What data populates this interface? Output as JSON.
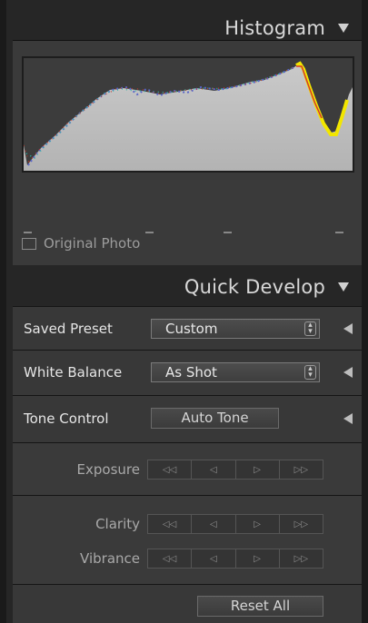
{
  "histogram": {
    "title": "Histogram",
    "original_photo_label": "Original Photo",
    "original_photo_checked": false
  },
  "quick_develop": {
    "title": "Quick Develop",
    "saved_preset": {
      "label": "Saved Preset",
      "value": "Custom"
    },
    "white_balance": {
      "label": "White Balance",
      "value": "As Shot"
    },
    "tone_control": {
      "label": "Tone Control",
      "auto_tone_label": "Auto Tone"
    },
    "steppers": [
      {
        "label": "Exposure"
      },
      {
        "label": "Clarity"
      },
      {
        "label": "Vibrance"
      }
    ],
    "stepper_glyphs": [
      "◁◁",
      "◁",
      "▷",
      "▷▷"
    ],
    "reset_all_label": "Reset All"
  },
  "colors": {
    "panel_bg": "#383838",
    "histogram_fill": "#bfbfbf",
    "highlight_yellow": "#f2e600"
  }
}
